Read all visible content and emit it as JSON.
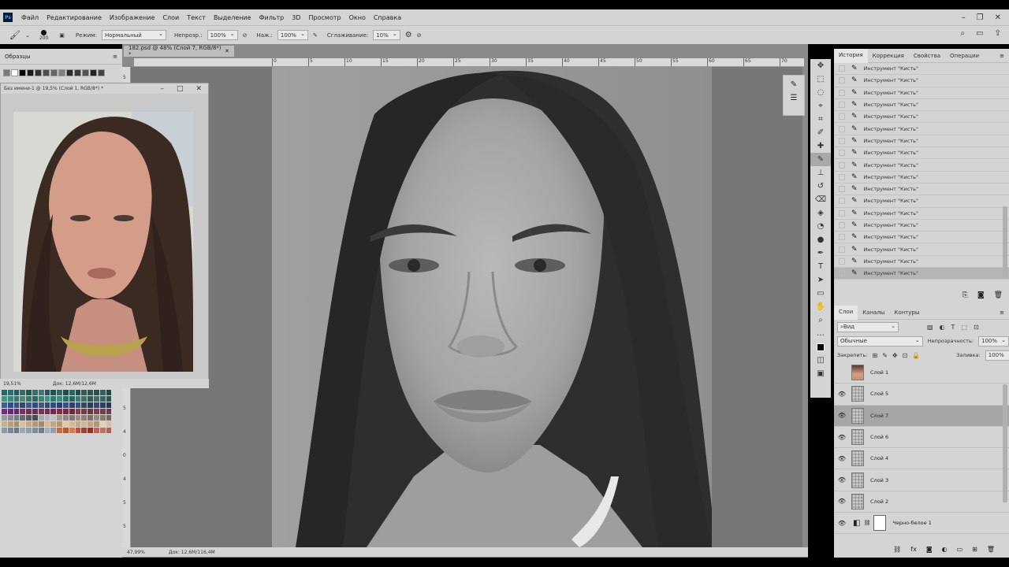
{
  "menu": {
    "items": [
      "Файл",
      "Редактирование",
      "Изображение",
      "Слои",
      "Текст",
      "Выделение",
      "Фильтр",
      "3D",
      "Просмотр",
      "Окно",
      "Справка"
    ]
  },
  "options": {
    "brush_size": "200",
    "mode_label": "Режим:",
    "mode_value": "Нормальный",
    "opacity_label": "Непрозр.:",
    "opacity_value": "100%",
    "flow_label": "Наж.:",
    "flow_value": "100%",
    "smoothing_label": "Сглаживание:",
    "smoothing_value": "10%"
  },
  "swatches_panel": {
    "title": "Образцы",
    "top_colors": [
      "#7a7a7a",
      "#ffffff",
      "#000000",
      "#1a1a1a",
      "#333333",
      "#4d4d4d",
      "#666666",
      "#808080",
      "#2b2b2b",
      "#3a3a3a",
      "#555555",
      "#222222",
      "#444444"
    ],
    "grid_colors": [
      "#1d6a6b",
      "#237373",
      "#1b5f5f",
      "#2a6e6e",
      "#1a5a5a",
      "#2c7272",
      "#3a7a7a",
      "#20585e",
      "#155555",
      "#2e6a6a",
      "#1c4f4f",
      "#286565",
      "#1a5050",
      "#2a5f5f",
      "#205a5a",
      "#1d5555",
      "#2b6262",
      "#174949",
      "#3a9a86",
      "#2f8f7b",
      "#2a7f6e",
      "#3d8f80",
      "#278070",
      "#1f7060",
      "#2e8a74",
      "#349680",
      "#2b7c6a",
      "#3a8e7f",
      "#2a7466",
      "#1f6a5c",
      "#337f70",
      "#2c7869",
      "#265f55",
      "#30756a",
      "#2a6d62",
      "#205a50",
      "#3a5f9a",
      "#2e4f8a",
      "#3a4d85",
      "#2c4a7c",
      "#395aa0",
      "#2b4b90",
      "#3d5a8e",
      "#2f4a80",
      "#324e88",
      "#283f75",
      "#3a508a",
      "#2c3f70",
      "#384f84",
      "#2f466f",
      "#283b66",
      "#334a7a",
      "#2b4068",
      "#22355a",
      "#7a2a8a",
      "#6a2a7c",
      "#5a2a75",
      "#842a6e",
      "#7a2760",
      "#6e2a58",
      "#8a2a62",
      "#7c2a55",
      "#702a50",
      "#882a4a",
      "#7a2a40",
      "#6a2a38",
      "#8c3a4a",
      "#7a3a40",
      "#6a3a38",
      "#883a50",
      "#7a3a48",
      "#6a3a42",
      "#9a9a9a",
      "#8a8a8a",
      "#7a7a7a",
      "#6a6a6a",
      "#5a5a5a",
      "#4a4a4a",
      "#a9a9a9",
      "#b5b5b5",
      "#c0c0c0",
      "#9f9890",
      "#8f887f",
      "#7f7870",
      "#a08f80",
      "#908070",
      "#807060",
      "#9a8a7a",
      "#8a7a6a",
      "#7a6a5a",
      "#c8b08a",
      "#b8a07a",
      "#a8906a",
      "#d8c09a",
      "#c9a880",
      "#b99870",
      "#a98860",
      "#d9b890",
      "#c9a478",
      "#b99468",
      "#e8c8a0",
      "#d8b890",
      "#c8a880",
      "#e0b080",
      "#d0a070",
      "#c09060",
      "#e8d0a8",
      "#d8c098",
      "#8a9aa8",
      "#7a8a98",
      "#6a7a88",
      "#9aaab8",
      "#8aa0b0",
      "#7a90a0",
      "#6a8090",
      "#a0b0c0",
      "#90a0b0",
      "#c86a3a",
      "#b85a2a",
      "#d87a4a",
      "#c84a3a",
      "#b83a2a",
      "#a82a1a",
      "#d85a4a",
      "#c87060",
      "#b86050"
    ]
  },
  "float_window": {
    "title": "Без имени-1 @ 19,5% (Слой 1, RGB/8*) *",
    "zoom": "19,51%",
    "doc_size": "Док: 12,6M/12,6M"
  },
  "document": {
    "tab_title": "182.psd @ 48% (Слой 7, RGB/8*) *",
    "zoom": "47,99%",
    "doc_size": "Док: 12,6M/116,4M",
    "ruler_h_labels": [
      "0",
      "5",
      "10",
      "15",
      "20",
      "25",
      "30",
      "35",
      "40",
      "45",
      "50",
      "55",
      "60",
      "65",
      "70"
    ],
    "ruler_v_labels": [
      "5",
      "0",
      "5",
      "1",
      "0",
      "1",
      "5",
      "2",
      "0",
      "2",
      "5",
      "3",
      "0",
      "3",
      "5",
      "4",
      "0",
      "4",
      "5",
      "5"
    ]
  },
  "history_panel": {
    "tabs": [
      "История",
      "Коррекция",
      "Свойства",
      "Операции"
    ],
    "active_tab": "История",
    "items": [
      "Инструмент \"Кисть\"",
      "Инструмент \"Кисть\"",
      "Инструмент \"Кисть\"",
      "Инструмент \"Кисть\"",
      "Инструмент \"Кисть\"",
      "Инструмент \"Кисть\"",
      "Инструмент \"Кисть\"",
      "Инструмент \"Кисть\"",
      "Инструмент \"Кисть\"",
      "Инструмент \"Кисть\"",
      "Инструмент \"Кисть\"",
      "Инструмент \"Кисть\"",
      "Инструмент \"Кисть\"",
      "Инструмент \"Кисть\"",
      "Инструмент \"Кисть\"",
      "Инструмент \"Кисть\"",
      "Инструмент \"Кисть\"",
      "Инструмент \"Кисть\""
    ]
  },
  "layers_panel": {
    "tabs": [
      "Слои",
      "Каналы",
      "Контуры"
    ],
    "active_tab": "Слои",
    "filter_label": "Вид",
    "blend_mode": "Обычные",
    "opacity_label": "Непрозрачность:",
    "opacity_value": "100%",
    "lock_label": "Закрепить:",
    "fill_label": "Заливка:",
    "fill_value": "100%",
    "layers": [
      {
        "name": "Слой 1",
        "visible": false,
        "kind": "photo",
        "selected": false
      },
      {
        "name": "Слой 5",
        "visible": true,
        "kind": "raster",
        "selected": false
      },
      {
        "name": "Слой 7",
        "visible": true,
        "kind": "raster",
        "selected": true
      },
      {
        "name": "Слой 6",
        "visible": true,
        "kind": "raster",
        "selected": false
      },
      {
        "name": "Слой 4",
        "visible": true,
        "kind": "raster",
        "selected": false
      },
      {
        "name": "Слой 3",
        "visible": true,
        "kind": "raster",
        "selected": false
      },
      {
        "name": "Слой 2",
        "visible": true,
        "kind": "raster",
        "selected": false
      },
      {
        "name": "Черно-белое 1",
        "visible": true,
        "kind": "adjustment",
        "selected": false
      }
    ]
  },
  "colors": {
    "panel_bg": "#d4d4d4",
    "canvas_bg": "#8a8a8a",
    "selected_layer": "#a6a6a6",
    "ps_blue": "#31a8ff"
  }
}
